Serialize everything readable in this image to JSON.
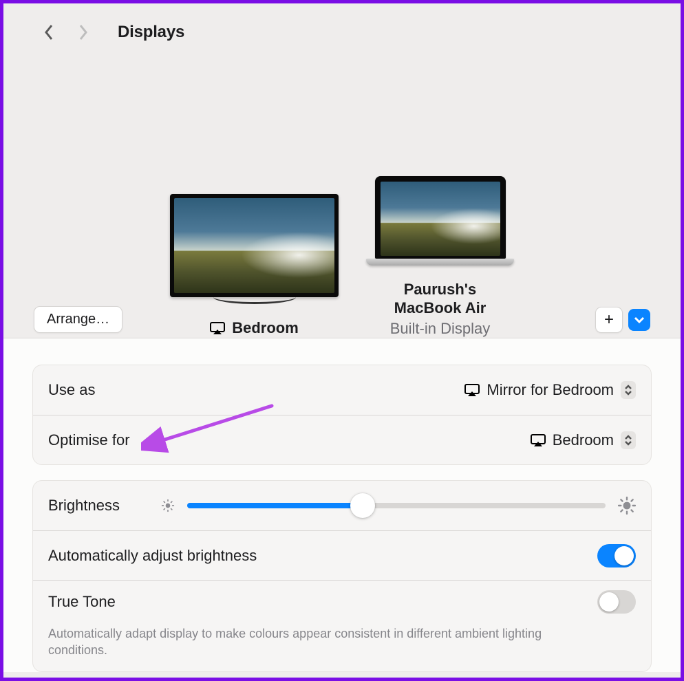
{
  "header": {
    "title": "Displays"
  },
  "displays": {
    "external": {
      "label": "Bedroom"
    },
    "builtin": {
      "name_line1": "Paurush's",
      "name_line2": "MacBook Air",
      "subtitle": "Built-in Display"
    }
  },
  "buttons": {
    "arrange": "Arrange…",
    "plus": "+"
  },
  "settings": {
    "use_as": {
      "label": "Use as",
      "value": "Mirror for Bedroom"
    },
    "optimise_for": {
      "label": "Optimise for",
      "value": "Bedroom"
    },
    "brightness": {
      "label": "Brightness",
      "percent": 42
    },
    "auto_brightness": {
      "label": "Automatically adjust brightness",
      "on": true
    },
    "true_tone": {
      "label": "True Tone",
      "description": "Automatically adapt display to make colours appear consistent in different ambient lighting conditions.",
      "on": false
    }
  },
  "annotation": {
    "color": "#b84be7"
  }
}
